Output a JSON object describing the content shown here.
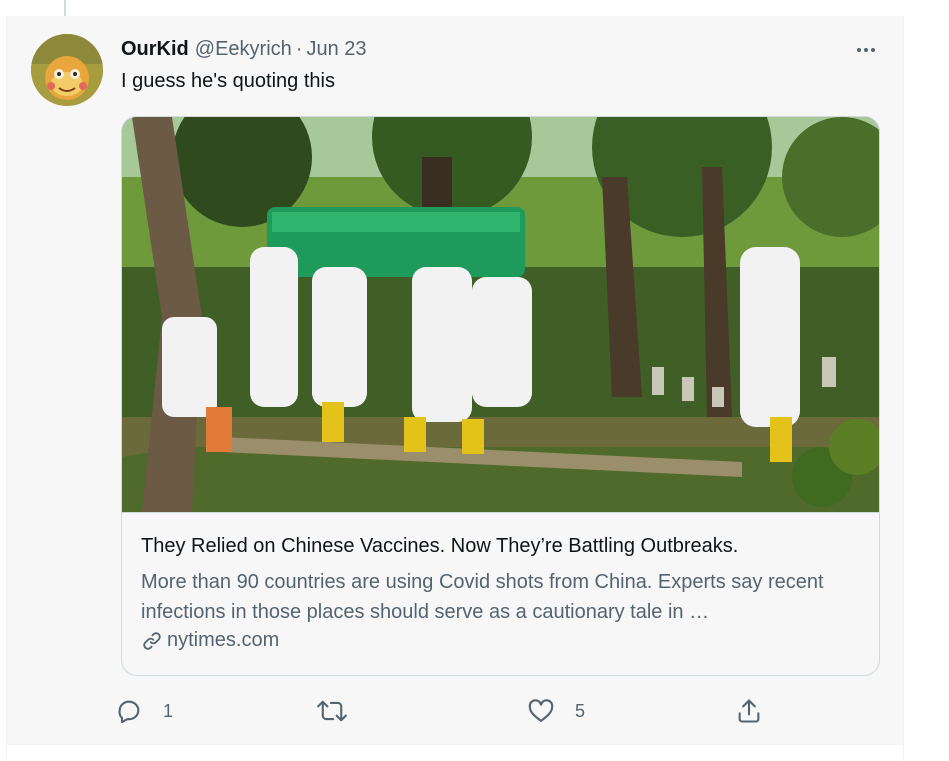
{
  "tweet": {
    "author_name": "OurKid",
    "author_handle": "@Eekyrich",
    "separator": "·",
    "date": "Jun 23",
    "text": "I guess he's quoting this"
  },
  "card": {
    "image_icon": "photo-funeral-procession",
    "title": "They Relied on Chinese Vaccines. Now They’re Battling Outbreaks.",
    "description": "More than 90 countries are using Covid shots from China. Experts say recent infections in those places should serve as a cautionary tale in …",
    "domain_icon": "link-icon",
    "domain": "nytimes.com"
  },
  "actions": {
    "reply_count": "1",
    "retweet_count": "",
    "like_count": "5",
    "share_count": ""
  },
  "icons": [
    "more-icon",
    "reply-icon",
    "retweet-icon",
    "like-icon",
    "share-icon",
    "link-icon"
  ],
  "colors": {
    "text_primary": "#0f1419",
    "text_secondary": "#536471",
    "border": "#cfd9de",
    "background": "#f7f7f7"
  }
}
